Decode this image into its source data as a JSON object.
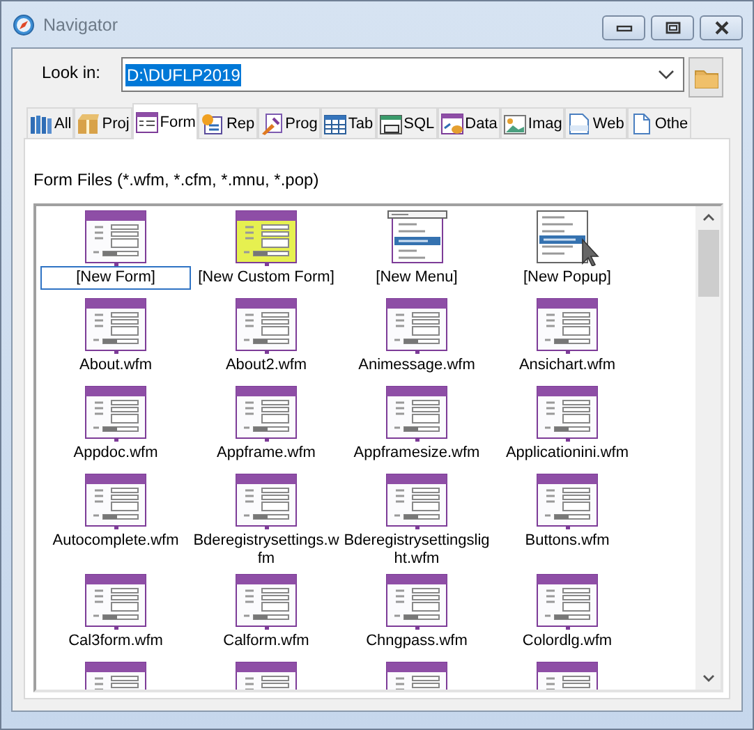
{
  "window": {
    "title": "Navigator"
  },
  "look_in": {
    "label": "Look in:",
    "value": "D:\\DUFLP2019",
    "text_selected": true
  },
  "tabs": [
    {
      "label": "All",
      "kind": "all",
      "selected": false
    },
    {
      "label": "Proj",
      "kind": "project",
      "selected": false
    },
    {
      "label": "Form",
      "kind": "form",
      "selected": true
    },
    {
      "label": "Rep",
      "kind": "report",
      "selected": false
    },
    {
      "label": "Prog",
      "kind": "program",
      "selected": false
    },
    {
      "label": "Tab",
      "kind": "table",
      "selected": false
    },
    {
      "label": "SQL",
      "kind": "sql",
      "selected": false
    },
    {
      "label": "Data",
      "kind": "data",
      "selected": false
    },
    {
      "label": "Imag",
      "kind": "image",
      "selected": false
    },
    {
      "label": "Web",
      "kind": "web",
      "selected": false
    },
    {
      "label": "Othe",
      "kind": "other",
      "selected": false
    }
  ],
  "filter_label": "Form Files (*.wfm, *.cfm, *.mnu, *.pop)",
  "files": [
    {
      "label": "[New Form]",
      "kind": "form",
      "selected": true
    },
    {
      "label": "[New Custom Form]",
      "kind": "custom",
      "selected": false
    },
    {
      "label": "[New Menu]",
      "kind": "menu",
      "selected": false
    },
    {
      "label": "[New Popup]",
      "kind": "popup",
      "selected": false
    },
    {
      "label": "About.wfm",
      "kind": "form",
      "selected": false
    },
    {
      "label": "About2.wfm",
      "kind": "form",
      "selected": false
    },
    {
      "label": "Animessage.wfm",
      "kind": "form",
      "selected": false
    },
    {
      "label": "Ansichart.wfm",
      "kind": "form",
      "selected": false
    },
    {
      "label": "Appdoc.wfm",
      "kind": "form",
      "selected": false
    },
    {
      "label": "Appframe.wfm",
      "kind": "form",
      "selected": false
    },
    {
      "label": "Appframesize.wfm",
      "kind": "form",
      "selected": false
    },
    {
      "label": "Applicationini.wfm",
      "kind": "form",
      "selected": false
    },
    {
      "label": "Autocomplete.wfm",
      "kind": "form",
      "selected": false
    },
    {
      "label": "Bderegistrysettings.wfm",
      "kind": "form",
      "selected": false
    },
    {
      "label": "Bderegistrysettingslight.wfm",
      "kind": "form",
      "selected": false
    },
    {
      "label": "Buttons.wfm",
      "kind": "form",
      "selected": false
    },
    {
      "label": "Cal3form.wfm",
      "kind": "form",
      "selected": false
    },
    {
      "label": "Calform.wfm",
      "kind": "form",
      "selected": false
    },
    {
      "label": "Chngpass.wfm",
      "kind": "form",
      "selected": false
    },
    {
      "label": "Colordlg.wfm",
      "kind": "form",
      "selected": false
    },
    {
      "kind": "form",
      "selected": false
    },
    {
      "kind": "form",
      "selected": false
    },
    {
      "kind": "form",
      "selected": false
    },
    {
      "kind": "form",
      "selected": false
    }
  ]
}
